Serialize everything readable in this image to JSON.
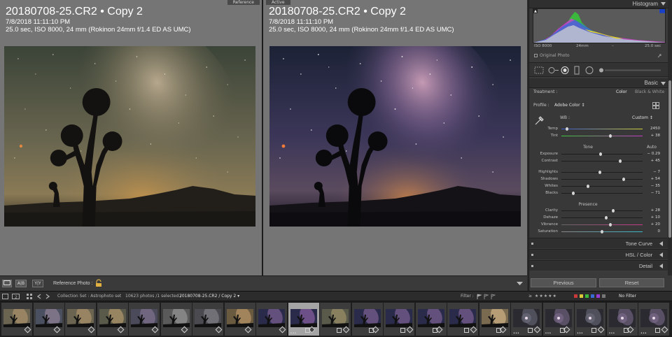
{
  "reference": {
    "tag": "Reference",
    "title": "20180708-25.CR2  •  Copy 2",
    "date": "7/8/2018 11:11:10 PM",
    "exif": "25.0 sec, ISO 8000, 24 mm (Rokinon 24mm f/1.4 ED AS UMC)"
  },
  "active": {
    "tag": "Active",
    "title": "20180708-25.CR2  •  Copy 2",
    "date": "7/8/2018 11:11:10 PM",
    "exif": "25.0 sec, ISO 8000, 24 mm (Rokinon 24mm f/1.4 ED AS UMC)"
  },
  "compare_toolbar": {
    "view_ab": "A|B",
    "view_yy": "Y|Y",
    "reference_photo_label": "Reference Photo :",
    "lock_icon": "lock-icon"
  },
  "histogram": {
    "header": "Histogram",
    "iso": "ISO 8000",
    "focal": "24mm",
    "aperture": "–",
    "shutter": "25.0 sec",
    "original_photo": "Original Photo"
  },
  "basic": {
    "header": "Basic",
    "treatment_label": "Treatment :",
    "treatment_color": "Color",
    "treatment_bw": "Black & White",
    "profile_label": "Profile :",
    "profile_value": "Adobe Color ↕",
    "wb_label": "WB :",
    "wb_value": "Custom ↕",
    "tone_label": "Tone",
    "tone_auto": "Auto",
    "presence_label": "Presence",
    "sliders_wb": [
      {
        "label": "Temp",
        "value": "2450",
        "pos": 0.07
      },
      {
        "label": "Tint",
        "value": "+ 38",
        "pos": 0.6
      }
    ],
    "sliders_tone": [
      {
        "label": "Exposure",
        "value": "− 0.29",
        "pos": 0.48
      },
      {
        "label": "Contrast",
        "value": "+ 45",
        "pos": 0.72
      }
    ],
    "sliders_tone2": [
      {
        "label": "Highlights",
        "value": "− 7",
        "pos": 0.47
      },
      {
        "label": "Shadows",
        "value": "+ 54",
        "pos": 0.77
      },
      {
        "label": "Whites",
        "value": "− 35",
        "pos": 0.33
      },
      {
        "label": "Blacks",
        "value": "− 71",
        "pos": 0.15
      }
    ],
    "sliders_presence": [
      {
        "label": "Clarity",
        "value": "+ 28",
        "pos": 0.64
      },
      {
        "label": "Dehaze",
        "value": "+ 10",
        "pos": 0.55
      },
      {
        "label": "Vibrance",
        "value": "+ 20",
        "pos": 0.6
      },
      {
        "label": "Saturation",
        "value": "0",
        "pos": 0.5
      }
    ]
  },
  "panels": {
    "tone_curve": "Tone Curve",
    "hsl": "HSL / Color",
    "detail": "Detail"
  },
  "buttons": {
    "previous": "Previous",
    "reset": "Reset"
  },
  "filmbar": {
    "collection": "Collection Set : Astrophoto set",
    "count": "10623 photos /1 selected /",
    "current": "20180708-25.CR2 / Copy 2 ▾",
    "filter_label": "Filter :",
    "filter_value": "No Filter",
    "rating": "≥ ★★★★★"
  },
  "filmstrip": {
    "count": 21,
    "selected_index": 9
  },
  "colors": {
    "sky_ref": "#5b5a44",
    "sky_act": "#2a2a48",
    "milkyway": "#b89aa0",
    "accent_panel": "#3a3a3a"
  }
}
